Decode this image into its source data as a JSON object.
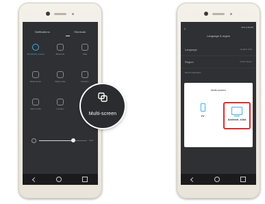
{
  "left_phone": {
    "tabs": [
      "Notifications",
      "Shortcuts"
    ],
    "tiles": [
      {
        "label": "Wi-Fi(DGK_Guest)",
        "active": true
      },
      {
        "label": "Bluetooth",
        "active": false
      },
      {
        "label": "Data",
        "active": false
      },
      {
        "label": "Multi-screen",
        "active": false
      },
      {
        "label": "Flight mode",
        "active": false
      },
      {
        "label": "Rotation",
        "active": false
      },
      {
        "label": "Silent mode",
        "active": false
      },
      {
        "label": "Location",
        "active": false
      },
      {
        "label": "",
        "active": false
      }
    ],
    "brightness": 0.72,
    "auto_label": "Auto"
  },
  "zoom": {
    "label": "Multi-screen",
    "icon": "multi-screen-icon"
  },
  "right_phone": {
    "status_right": "47% 2:45 PM",
    "title": "Language & region",
    "rows": [
      {
        "label": "Language",
        "value": "English (US)"
      },
      {
        "label": "Region",
        "value": "United States"
      }
    ],
    "section": "Recent selections",
    "dialog": {
      "title": "Multi-screen",
      "devices": [
        {
          "label": "TV",
          "icon": "phone-icon",
          "selected": false
        },
        {
          "label": "Android_e2a4",
          "icon": "tv-icon",
          "selected": true
        }
      ]
    }
  },
  "colors": {
    "accent": "#3fb0e6",
    "highlight": "#e02a2a",
    "screen": "#2f3033"
  }
}
